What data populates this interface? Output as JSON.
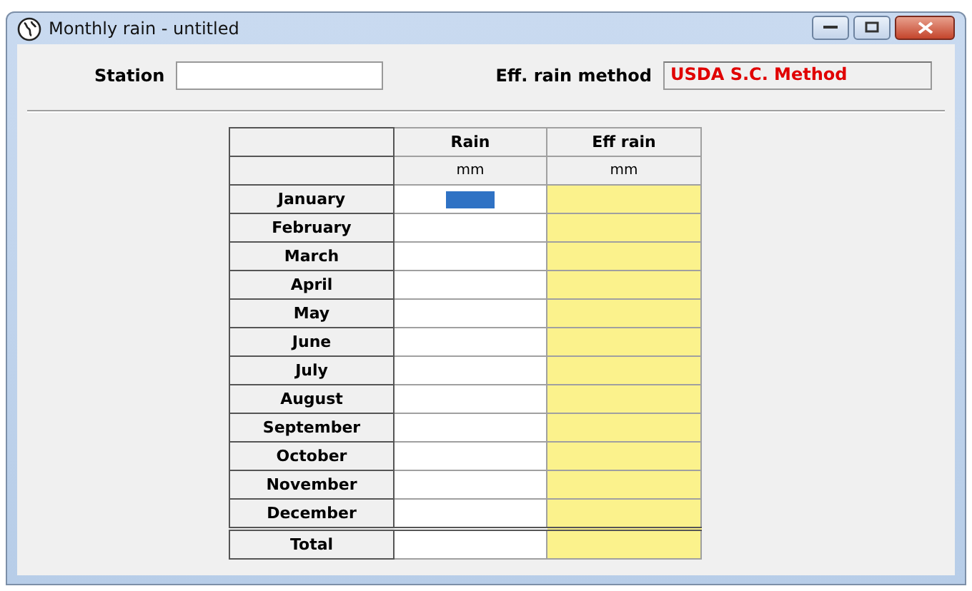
{
  "window": {
    "title": "Monthly rain - untitled"
  },
  "station": {
    "label": "Station"
  },
  "method": {
    "label": "Eff. rain method",
    "value": "USDA S.C. Method"
  },
  "table": {
    "columns": [
      {
        "label": "Rain",
        "unit": "mm"
      },
      {
        "label": "Eff rain",
        "unit": "mm"
      }
    ],
    "rows": [
      {
        "month": "January",
        "selected": true
      },
      {
        "month": "February",
        "selected": false
      },
      {
        "month": "March",
        "selected": false
      },
      {
        "month": "April",
        "selected": false
      },
      {
        "month": "May",
        "selected": false
      },
      {
        "month": "June",
        "selected": false
      },
      {
        "month": "July",
        "selected": false
      },
      {
        "month": "August",
        "selected": false
      },
      {
        "month": "September",
        "selected": false
      },
      {
        "month": "October",
        "selected": false
      },
      {
        "month": "November",
        "selected": false
      },
      {
        "month": "December",
        "selected": false
      }
    ],
    "total": {
      "label": "Total"
    }
  }
}
